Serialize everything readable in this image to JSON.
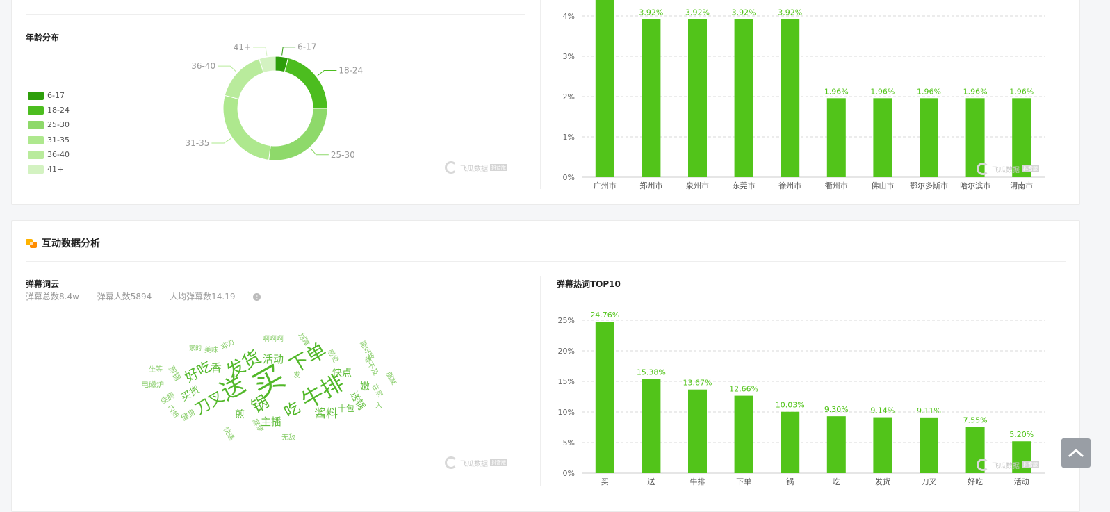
{
  "age_section": {
    "title": "年龄分布",
    "legend": [
      {
        "label": "6-17",
        "color": "#2d9e0a"
      },
      {
        "label": "18-24",
        "color": "#4cbd1f"
      },
      {
        "label": "25-30",
        "color": "#8ed96a"
      },
      {
        "label": "31-35",
        "color": "#aee88e"
      },
      {
        "label": "36-40",
        "color": "#b9eb9c"
      },
      {
        "label": "41+",
        "color": "#d3f2c1"
      }
    ],
    "chart_data": {
      "type": "pie",
      "labels": [
        "6-17",
        "18-24",
        "25-30",
        "31-35",
        "36-40",
        "41+"
      ],
      "values": [
        4,
        21,
        27,
        27,
        16,
        5
      ],
      "colors": [
        "#2d9e0a",
        "#4cbd1f",
        "#8ed96a",
        "#aee88e",
        "#b9eb9c",
        "#d3f2c1"
      ]
    }
  },
  "region_chart": {
    "chart_data": {
      "type": "bar",
      "categories": [
        "广州市",
        "郑州市",
        "泉州市",
        "东莞市",
        "徐州市",
        "衢州市",
        "佛山市",
        "鄂尔多斯市",
        "哈尔滨市",
        "渭南市"
      ],
      "values": [
        4.5,
        3.92,
        3.92,
        3.92,
        3.92,
        1.96,
        1.96,
        1.96,
        1.96,
        1.96
      ],
      "labels": [
        "",
        "3.92%",
        "3.92%",
        "3.92%",
        "3.92%",
        "1.96%",
        "1.96%",
        "1.96%",
        "1.96%",
        "1.96%"
      ],
      "ylim": [
        0,
        4
      ],
      "yticks": [
        "0%",
        "1%",
        "2%",
        "3%",
        "4%"
      ],
      "color": "#52c41a"
    }
  },
  "interaction_section": {
    "title": "互动数据分析",
    "cloud_title": "弹幕词云",
    "stats": {
      "total": "弹幕总数8.4w",
      "people": "弹幕人数5894",
      "avg": "人均弹幕数14.19"
    },
    "info_icon": "info-icon",
    "top10_title": "弹幕热词TOP10",
    "cloud_words": [
      {
        "text": "买",
        "size": 44,
        "rot": -30
      },
      {
        "text": "送",
        "size": 34,
        "rot": -30
      },
      {
        "text": "牛排",
        "size": 32,
        "rot": -30
      },
      {
        "text": "下单",
        "size": 28,
        "rot": -30
      },
      {
        "text": "发货",
        "size": 26,
        "rot": -30
      },
      {
        "text": "锅",
        "size": 24,
        "rot": -30
      },
      {
        "text": "吃",
        "size": 22,
        "rot": -30
      },
      {
        "text": "刀叉",
        "size": 22,
        "rot": -30
      },
      {
        "text": "好吃",
        "size": 20,
        "rot": -30
      },
      {
        "text": "酱料",
        "size": 17,
        "rot": 0
      },
      {
        "text": "主播",
        "size": 15,
        "rot": 0
      },
      {
        "text": "活动",
        "size": 15,
        "rot": 0
      },
      {
        "text": "快点",
        "size": 14,
        "rot": 0
      },
      {
        "text": "买货",
        "size": 14,
        "rot": -30
      },
      {
        "text": "煎",
        "size": 14,
        "rot": 0
      },
      {
        "text": "香",
        "size": 16,
        "rot": 0
      },
      {
        "text": "送锅",
        "size": 14,
        "rot": 60
      },
      {
        "text": "十包",
        "size": 12,
        "rot": 0
      },
      {
        "text": "嫩",
        "size": 14,
        "rot": 0
      },
      {
        "text": "健身",
        "size": 11,
        "rot": -30
      },
      {
        "text": "佳肠",
        "size": 11,
        "rot": -30
      },
      {
        "text": "煎锅",
        "size": 11,
        "rot": 60
      },
      {
        "text": "电磁炉",
        "size": 11,
        "rot": 0
      },
      {
        "text": "坐等",
        "size": 10,
        "rot": 0
      },
      {
        "text": "美味",
        "size": 10,
        "rot": 0
      },
      {
        "text": "非力",
        "size": 10,
        "rot": -30
      },
      {
        "text": "啊啊啊",
        "size": 10,
        "rot": 0
      },
      {
        "text": "划算",
        "size": 10,
        "rot": 60
      },
      {
        "text": "感觉",
        "size": 10,
        "rot": 60
      },
      {
        "text": "能好吃",
        "size": 10,
        "rot": 60
      },
      {
        "text": "等不及",
        "size": 10,
        "rot": 60
      },
      {
        "text": "在家",
        "size": 10,
        "rot": 60
      },
      {
        "text": "朋友",
        "size": 10,
        "rot": 60
      },
      {
        "text": "入",
        "size": 10,
        "rot": 0
      },
      {
        "text": "家的",
        "size": 9,
        "rot": 0
      },
      {
        "text": "无敌",
        "size": 10,
        "rot": 0
      },
      {
        "text": "麻烦",
        "size": 10,
        "rot": 60
      },
      {
        "text": "快递",
        "size": 10,
        "rot": 60
      },
      {
        "text": "内质",
        "size": 10,
        "rot": 60
      },
      {
        "text": "发",
        "size": 10,
        "rot": 0
      }
    ],
    "chart_data": {
      "type": "bar",
      "categories": [
        "买",
        "送",
        "牛排",
        "下单",
        "锅",
        "吃",
        "发货",
        "刀叉",
        "好吃",
        "活动"
      ],
      "values": [
        24.76,
        15.38,
        13.67,
        12.66,
        10.03,
        9.3,
        9.14,
        9.11,
        7.55,
        5.2
      ],
      "labels": [
        "24.76%",
        "15.38%",
        "13.67%",
        "12.66%",
        "10.03%",
        "9.30%",
        "9.14%",
        "9.11%",
        "7.55%",
        "5.20%"
      ],
      "ylim": [
        0,
        25
      ],
      "yticks": [
        "0%",
        "5%",
        "10%",
        "15%",
        "20%",
        "25%"
      ],
      "color": "#52c41a"
    }
  },
  "watermark": {
    "name": "飞瓜数据",
    "tag": "抖音版",
    "sub": "FEIGUA.CN"
  },
  "icons": {
    "scroll_top": "chevron-up-icon"
  }
}
